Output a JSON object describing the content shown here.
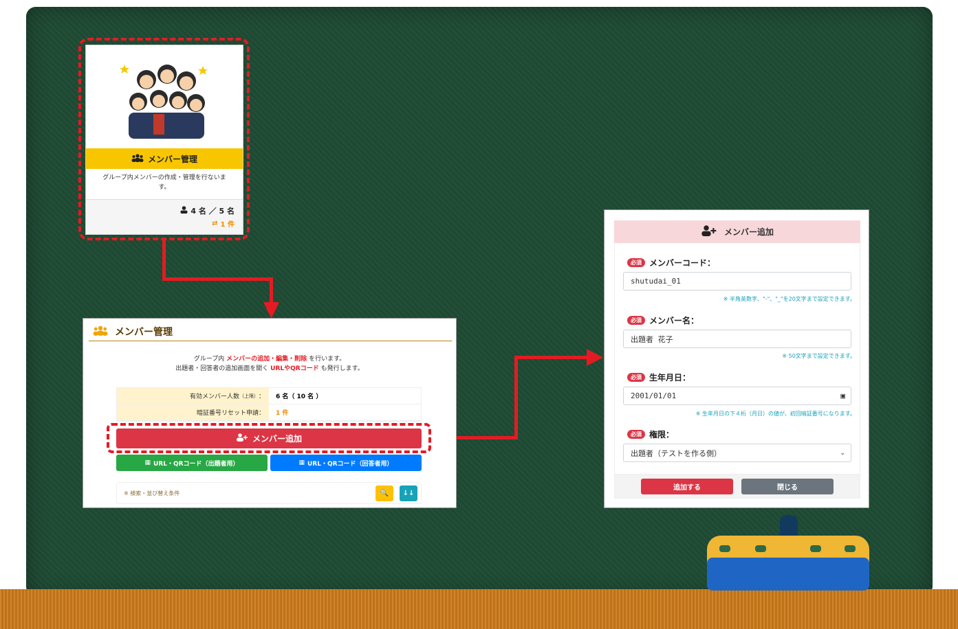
{
  "colors": {
    "board": "#1e4a33",
    "highlight": "#e41b23",
    "card_title_bg": "#f7c600",
    "add_button": "#dc3545",
    "qr_answerer": "#007bff",
    "qr_questioner": "#28a745"
  },
  "card": {
    "icon": "users-icon",
    "title": "メンバー管理",
    "description": "グループ内メンバーの作成・管理を行ないます。",
    "member_count": "4 名 ／ 5 名",
    "pending_count": "1 件"
  },
  "panel": {
    "title": "メンバー管理",
    "intro_1_pre": "グループ内",
    "intro_1_highlight": "メンバーの追加・編集・削除",
    "intro_1_post": "を行います。",
    "intro_2_pre": "出題者・回答者の追加画面を開く",
    "intro_2_highlight": "URLやQRコード",
    "intro_2_post": "も発行します。",
    "stats": [
      {
        "label": "有効メンバー人数",
        "label_small": "（上限）",
        "colon": "：",
        "value": "6 名（ 10 名 ）"
      },
      {
        "label": "暗証番号リセット申請",
        "label_small": "",
        "colon": "：",
        "value": "1 件"
      }
    ],
    "add_button": "メンバー追加",
    "qr_questioner": "URL・QRコード（出題者用）",
    "qr_answerer": "URL・QRコード（回答者用）",
    "search_label": "※ 検索・並び替え条件",
    "search_icon_text": "🔍",
    "sort_icon_text": "↓↓"
  },
  "modal": {
    "title": "メンバー追加",
    "required_badge": "必須",
    "fields": [
      {
        "label": "メンバーコード：",
        "value": "shutudai_01",
        "hint": "※ 半角英数字、\"-\"、\"_\"を20文字まで設定できます。"
      },
      {
        "label": "メンバー名：",
        "value": "出題者 花子",
        "hint": "※ 50文字まで設定できます。"
      },
      {
        "label": "生年月日：",
        "value": "2001/01/01",
        "hint": "※ 生年月日の下４桁（月日）の値が、初回暗証番号になります。"
      },
      {
        "label": "権限：",
        "value": "出題者（テストを作る側）",
        "hint": ""
      }
    ],
    "submit": "追加する",
    "close": "閉じる"
  }
}
